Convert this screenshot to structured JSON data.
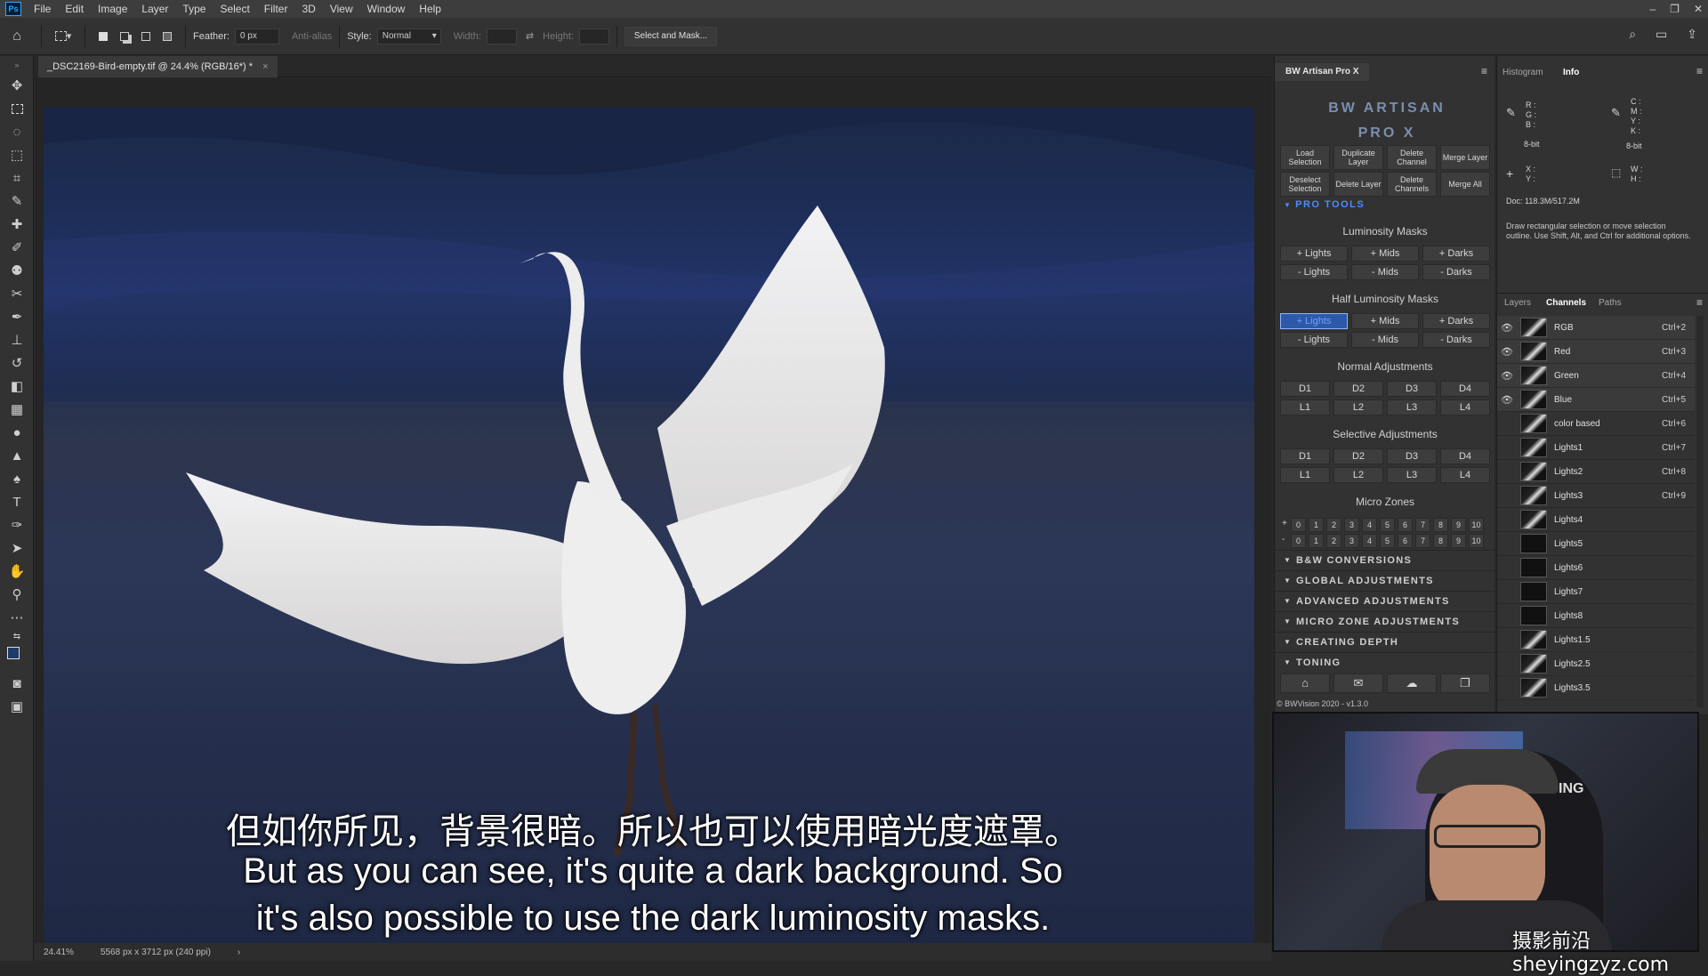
{
  "menubar": {
    "app_icon": "Ps",
    "items": [
      "File",
      "Edit",
      "Image",
      "Layer",
      "Type",
      "Select",
      "Filter",
      "3D",
      "View",
      "Window",
      "Help"
    ],
    "window_controls": [
      "–",
      "❐",
      "✕"
    ]
  },
  "options_bar": {
    "feather_label": "Feather:",
    "feather_value": "0 px",
    "antialias_label": "Anti-alias",
    "style_label": "Style:",
    "style_value": "Normal",
    "width_label": "Width:",
    "height_label": "Height:",
    "select_mask_label": "Select and Mask..."
  },
  "document": {
    "tab_title": "_DSC2169-Bird-empty.tif @ 24.4% (RGB/16*) *",
    "zoom": "24.41%",
    "doc_size": "5568 px x 3712 px (240 ppi)"
  },
  "subtitles": {
    "cn": "但如你所见，背景很暗。所以也可以使用暗光度遮罩。",
    "en1": "But as you can see, it's quite a dark background. So",
    "en2": "it's also possible to use the dark luminosity masks."
  },
  "bw_panel": {
    "tab": "BW Artisan Pro X",
    "logo": "BW ARTISAN PRO X",
    "top_buttons": [
      [
        "Load Selection",
        "Duplicate Layer",
        "Delete Channel",
        "Merge Layer"
      ],
      [
        "Deselect Selection",
        "Delete Layer",
        "Delete Channels",
        "Merge All"
      ]
    ],
    "pro_tools": "PRO TOOLS",
    "lum_title": "Luminosity Masks",
    "lum_plus": [
      "+ Lights",
      "+ Mids",
      "+ Darks"
    ],
    "lum_minus": [
      "- Lights",
      "- Mids",
      "- Darks"
    ],
    "half_title": "Half Luminosity Masks",
    "half_plus": [
      "+ Lights",
      "+ Mids",
      "+ Darks"
    ],
    "half_minus": [
      "- Lights",
      "- Mids",
      "- Darks"
    ],
    "normal_title": "Normal Adjustments",
    "normal_d": [
      "D1",
      "D2",
      "D3",
      "D4"
    ],
    "normal_l": [
      "L1",
      "L2",
      "L3",
      "L4"
    ],
    "selective_title": "Selective Adjustments",
    "selective_d": [
      "D1",
      "D2",
      "D3",
      "D4"
    ],
    "selective_l": [
      "L1",
      "L2",
      "L3",
      "L4"
    ],
    "micro_title": "Micro Zones",
    "micro_plus_sign": "+",
    "micro_minus_sign": "-",
    "micro_nums": [
      "0",
      "1",
      "2",
      "3",
      "4",
      "5",
      "6",
      "7",
      "8",
      "9",
      "10"
    ],
    "sections": [
      "B&W CONVERSIONS",
      "GLOBAL ADJUSTMENTS",
      "ADVANCED ADJUSTMENTS",
      "MICRO ZONE ADJUSTMENTS",
      "CREATING DEPTH",
      "TONING"
    ],
    "footer": "© BWVision 2020 - v1.3.0"
  },
  "info_panel": {
    "tabs": [
      "Histogram",
      "Info"
    ],
    "rgb_labels": "R :\nG :\nB :",
    "cmyk_labels": "C :\nM :\nY :\nK :",
    "bit_left": "8-bit",
    "bit_right": "8-bit",
    "xy_labels": "X :\nY :",
    "wh_labels": "W :\nH :",
    "doc": "Doc: 118.3M/517.2M",
    "hint": "Draw rectangular selection or move selection outline. Use Shift, Alt, and Ctrl for additional options."
  },
  "channels_panel": {
    "tabs": [
      "Layers",
      "Channels",
      "Paths"
    ],
    "rows": [
      {
        "name": "RGB",
        "key": "Ctrl+2",
        "eye": "👁"
      },
      {
        "name": "Red",
        "key": "Ctrl+3",
        "eye": "👁"
      },
      {
        "name": "Green",
        "key": "Ctrl+4",
        "eye": "👁"
      },
      {
        "name": "Blue",
        "key": "Ctrl+5",
        "eye": "👁"
      },
      {
        "name": "color based",
        "key": "Ctrl+6",
        "eye": ""
      },
      {
        "name": "Lights1",
        "key": "Ctrl+7",
        "eye": ""
      },
      {
        "name": "Lights2",
        "key": "Ctrl+8",
        "eye": ""
      },
      {
        "name": "Lights3",
        "key": "Ctrl+9",
        "eye": ""
      },
      {
        "name": "Lights4",
        "key": "",
        "eye": ""
      },
      {
        "name": "Lights5",
        "key": "",
        "eye": ""
      },
      {
        "name": "Lights6",
        "key": "",
        "eye": ""
      },
      {
        "name": "Lights7",
        "key": "",
        "eye": ""
      },
      {
        "name": "Lights8",
        "key": "",
        "eye": ""
      },
      {
        "name": "Lights1.5",
        "key": "",
        "eye": ""
      },
      {
        "name": "Lights2.5",
        "key": "",
        "eye": ""
      },
      {
        "name": "Lights3.5",
        "key": "",
        "eye": ""
      }
    ]
  },
  "webcam": {
    "chair_text": "ING"
  },
  "watermark": "摄影前沿 sheyingzyz.com"
}
